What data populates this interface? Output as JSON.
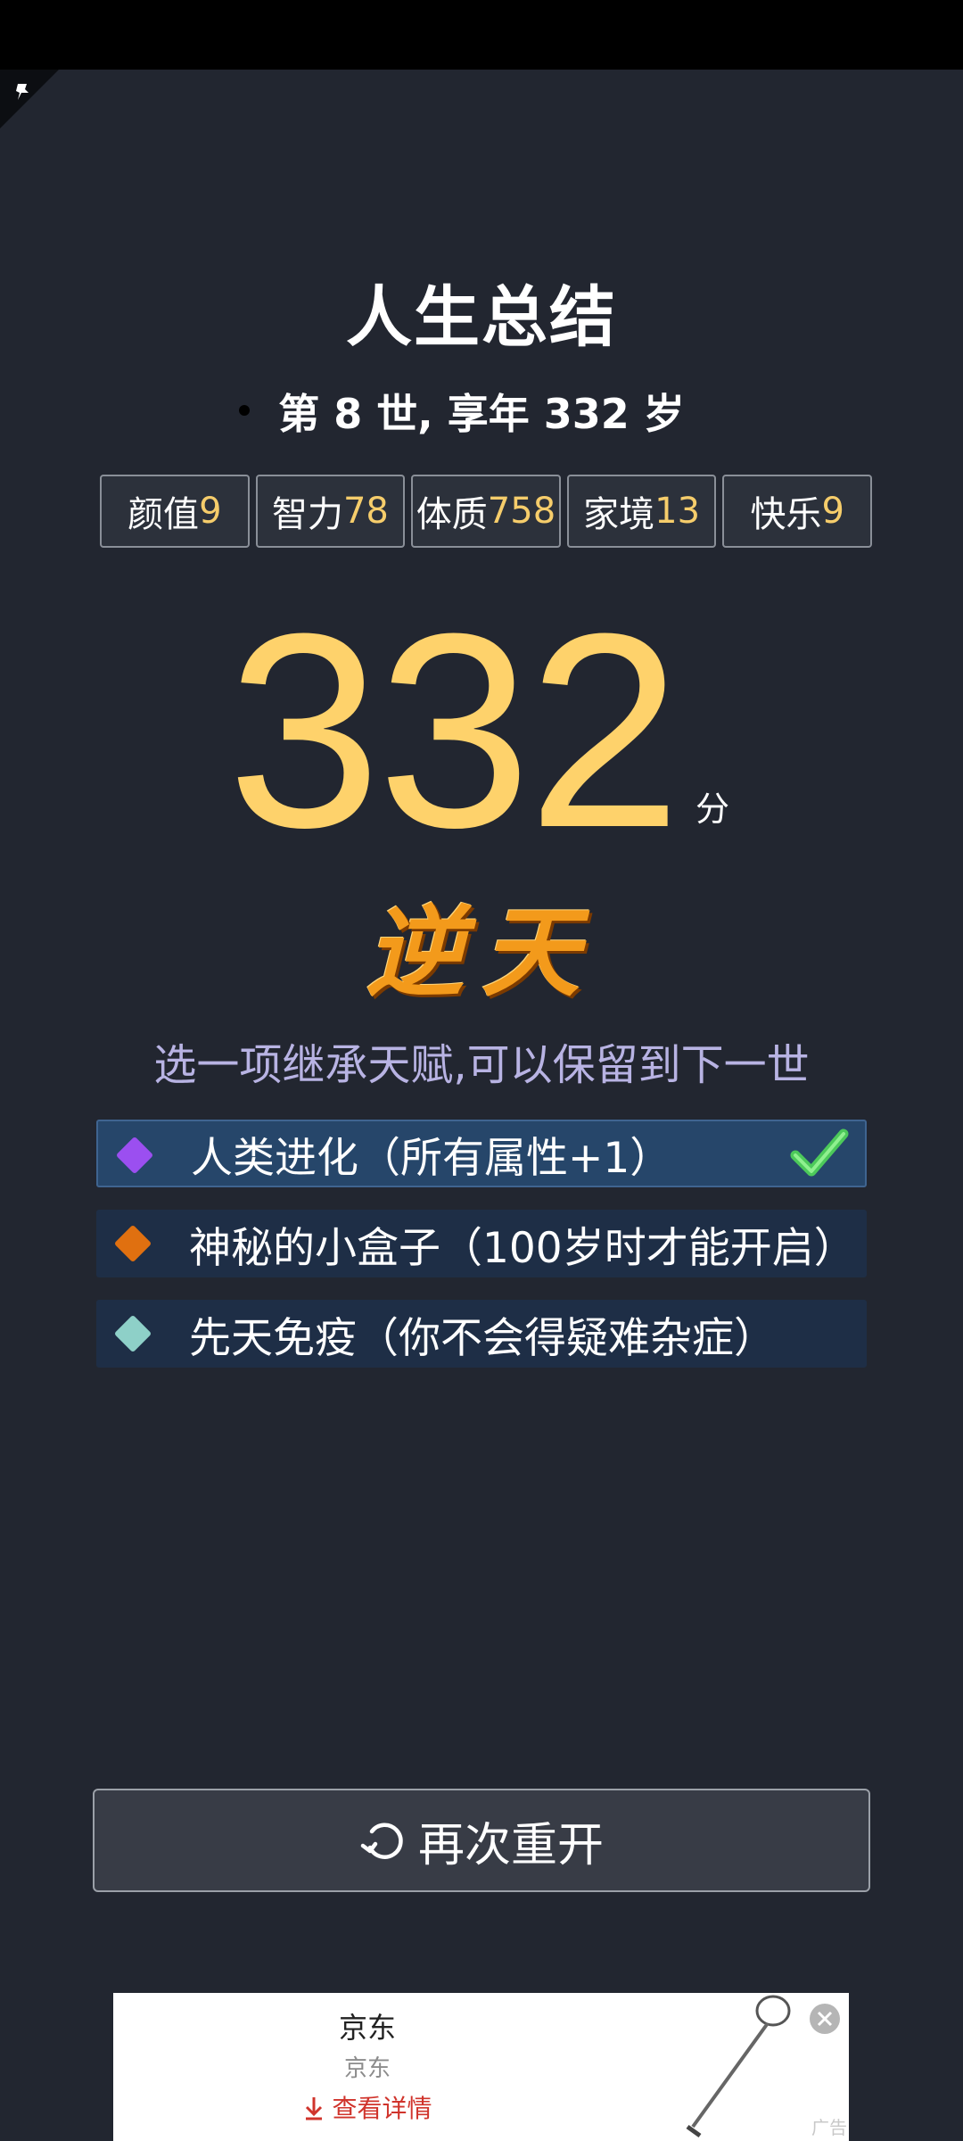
{
  "header": {
    "title": "人生总结",
    "subtitle": "第 8 世, 享年 332 岁"
  },
  "stats": [
    {
      "name": "颜值",
      "value": "9"
    },
    {
      "name": "智力",
      "value": "78"
    },
    {
      "name": "体质",
      "value": "758"
    },
    {
      "name": "家境",
      "value": "13"
    },
    {
      "name": "快乐",
      "value": "9"
    }
  ],
  "score": {
    "value": "332",
    "unit": "分",
    "grade": "逆天"
  },
  "inherit_prompt": "选一项继承天赋,可以保留到下一世",
  "talents": [
    {
      "label": "人类进化（所有属性+1）",
      "gem_color": "#9b4ff0",
      "selected": true
    },
    {
      "label": "神秘的小盒子（100岁时才能开启）",
      "gem_color": "#e07010",
      "selected": false
    },
    {
      "label": "先天免疫（你不会得疑难杂症）",
      "gem_color": "#8ed0c8",
      "selected": false
    }
  ],
  "restart_button": {
    "label": "再次重开"
  },
  "ad": {
    "title": "京东",
    "subtitle": "京东",
    "link": "查看详情",
    "tag": "广告"
  },
  "colors": {
    "background": "#222630",
    "score": "#fed26b",
    "stat_value": "#f6cd6b",
    "prompt": "#b8b3e3",
    "grade": "#f39a1b"
  }
}
